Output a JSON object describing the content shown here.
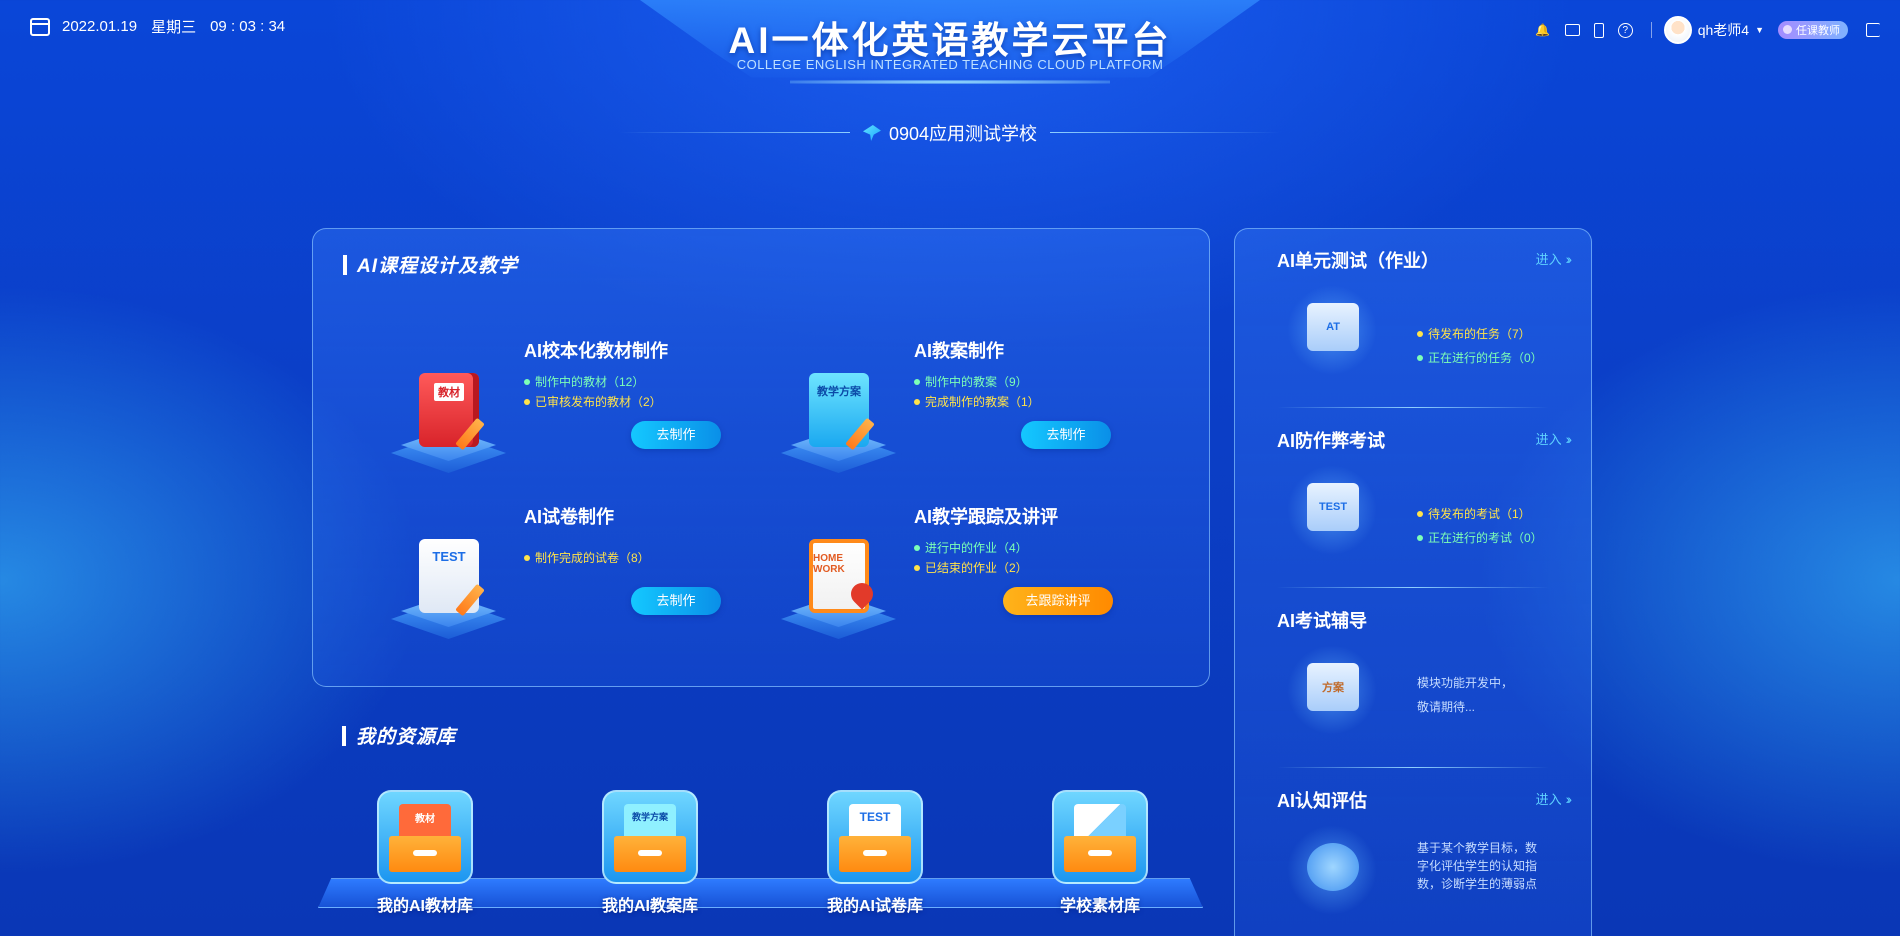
{
  "header": {
    "date": "2022.01.19",
    "weekday": "星期三",
    "time": "09 : 03 : 34",
    "title": "AI一体化英语教学云平台",
    "subtitle": "COLLEGE ENGLISH INTEGRATED TEACHING CLOUD PLATFORM",
    "username": "qh老师4",
    "role": "任课教师",
    "icons": [
      "bell-icon",
      "download-monitor-icon",
      "mobile-icon",
      "help-icon",
      "logout-icon"
    ]
  },
  "school": {
    "name": "0904应用测试学校"
  },
  "course_section": {
    "title": "AI课程设计及教学",
    "cards": [
      {
        "title": "AI校本化教材制作",
        "icon": "textbook-icon",
        "icon_label": "教材",
        "stats": [
          {
            "text": "制作中的教材（12）",
            "color": "green"
          },
          {
            "text": "已审核发布的教材（2）",
            "color": "yellow"
          }
        ],
        "button": "去制作"
      },
      {
        "title": "AI教案制作",
        "icon": "lesson-plan-icon",
        "icon_label": "教学方案",
        "stats": [
          {
            "text": "制作中的教案（9）",
            "color": "green"
          },
          {
            "text": "完成制作的教案（1）",
            "color": "yellow"
          }
        ],
        "button": "去制作"
      },
      {
        "title": "AI试卷制作",
        "icon": "test-paper-icon",
        "icon_label": "TEST",
        "stats": [
          {
            "text": "制作完成的试卷（8）",
            "color": "yellow"
          }
        ],
        "button": "去制作"
      },
      {
        "title": "AI教学跟踪及讲评",
        "icon": "homework-icon",
        "icon_label": "HOME WORK",
        "stats": [
          {
            "text": "进行中的作业（4）",
            "color": "green"
          },
          {
            "text": "已结束的作业（2）",
            "color": "yellow"
          }
        ],
        "button": "去跟踪讲评"
      }
    ]
  },
  "resource_section": {
    "title": "我的资源库",
    "items": [
      {
        "label": "我的AI教材库",
        "paper": "教材"
      },
      {
        "label": "我的AI教案库",
        "paper": "教学方案"
      },
      {
        "label": "我的AI试卷库",
        "paper": "TEST"
      },
      {
        "label": "学校素材库",
        "paper": ""
      }
    ]
  },
  "side_panel": {
    "enter_label": "进入",
    "items": [
      {
        "title": "AI单元测试（作业）",
        "has_enter": true,
        "icon": "unit-test-icon",
        "icon_label": "AT",
        "stats": [
          {
            "text": "待发布的任务（7）",
            "color": "yellow"
          },
          {
            "text": "正在进行的任务（0）",
            "color": "green"
          }
        ]
      },
      {
        "title": "AI防作弊考试",
        "has_enter": true,
        "icon": "anti-cheat-exam-icon",
        "icon_label": "TEST",
        "stats": [
          {
            "text": "待发布的考试（1）",
            "color": "yellow"
          },
          {
            "text": "正在进行的考试（0）",
            "color": "green"
          }
        ]
      },
      {
        "title": "AI考试辅导",
        "has_enter": false,
        "icon": "exam-tutoring-icon",
        "icon_label": "方案",
        "desc_lines": [
          "模块功能开发中，",
          "敬请期待..."
        ]
      },
      {
        "title": "AI认知评估",
        "has_enter": true,
        "icon": "cognitive-assessment-icon",
        "icon_label": "",
        "desc_lines": [
          "基于某个教学目标，数",
          "字化评估学生的认知指",
          "数，诊断学生的薄弱点"
        ]
      }
    ]
  },
  "colors": {
    "background": "#0a3fc8",
    "accent_cyan": "#14c8ff",
    "accent_orange": "#ff8a00",
    "stat_green": "#7dffb6",
    "stat_yellow": "#ffe34a",
    "enter_link": "#5fd2ff"
  }
}
